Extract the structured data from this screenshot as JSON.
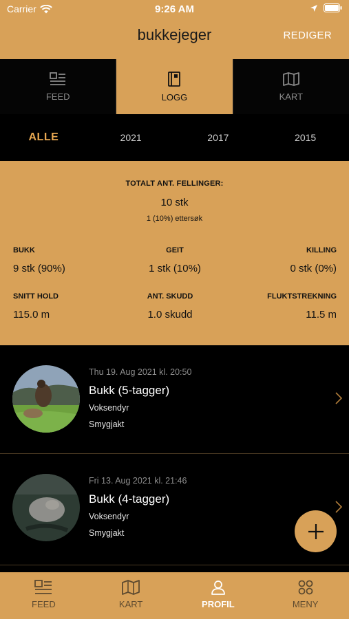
{
  "status": {
    "carrier": "Carrier",
    "time": "9:26 AM"
  },
  "header": {
    "title": "bukkejeger",
    "edit_label": "REDIGER"
  },
  "tabs": [
    {
      "label": "FEED",
      "icon": "feed-icon",
      "active": false
    },
    {
      "label": "LOGG",
      "icon": "logbook-icon",
      "active": true
    },
    {
      "label": "KART",
      "icon": "map-icon",
      "active": false
    }
  ],
  "years": [
    {
      "label": "ALLE",
      "active": true
    },
    {
      "label": "2021",
      "active": false
    },
    {
      "label": "2017",
      "active": false
    },
    {
      "label": "2015",
      "active": false
    }
  ],
  "stats": {
    "total_label": "TOTALT ANT. FELLINGER:",
    "total_value": "10 stk",
    "total_sub": "1 (10%) ettersøk",
    "bukk_label": "BUKK",
    "bukk_value": "9 stk (90%)",
    "geit_label": "GEIT",
    "geit_value": "1 stk (10%)",
    "killing_label": "KILLING",
    "killing_value": "0 stk (0%)",
    "hold_label": "SNITT HOLD",
    "hold_value": "115.0 m",
    "skudd_label": "ANT. SKUDD",
    "skudd_value": "1.0 skudd",
    "flukt_label": "FLUKTSTREKNING",
    "flukt_value": "11.5 m"
  },
  "entries": [
    {
      "date": "Thu 19. Aug 2021 kl. 20:50",
      "title": "Bukk (5-tagger)",
      "age": "Voksendyr",
      "method": "Smygjakt"
    },
    {
      "date": "Fri 13. Aug 2021 kl. 21:46",
      "title": "Bukk (4-tagger)",
      "age": "Voksendyr",
      "method": "Smygjakt"
    }
  ],
  "bottom_nav": [
    {
      "label": "FEED",
      "icon": "feed-icon",
      "active": false
    },
    {
      "label": "KART",
      "icon": "map-icon",
      "active": false
    },
    {
      "label": "PROFIL",
      "icon": "person-icon",
      "active": true
    },
    {
      "label": "MENY",
      "icon": "grid-icon",
      "active": false
    }
  ],
  "colors": {
    "accent": "#d8a158",
    "background": "#000000",
    "year_active": "#e8a851"
  }
}
